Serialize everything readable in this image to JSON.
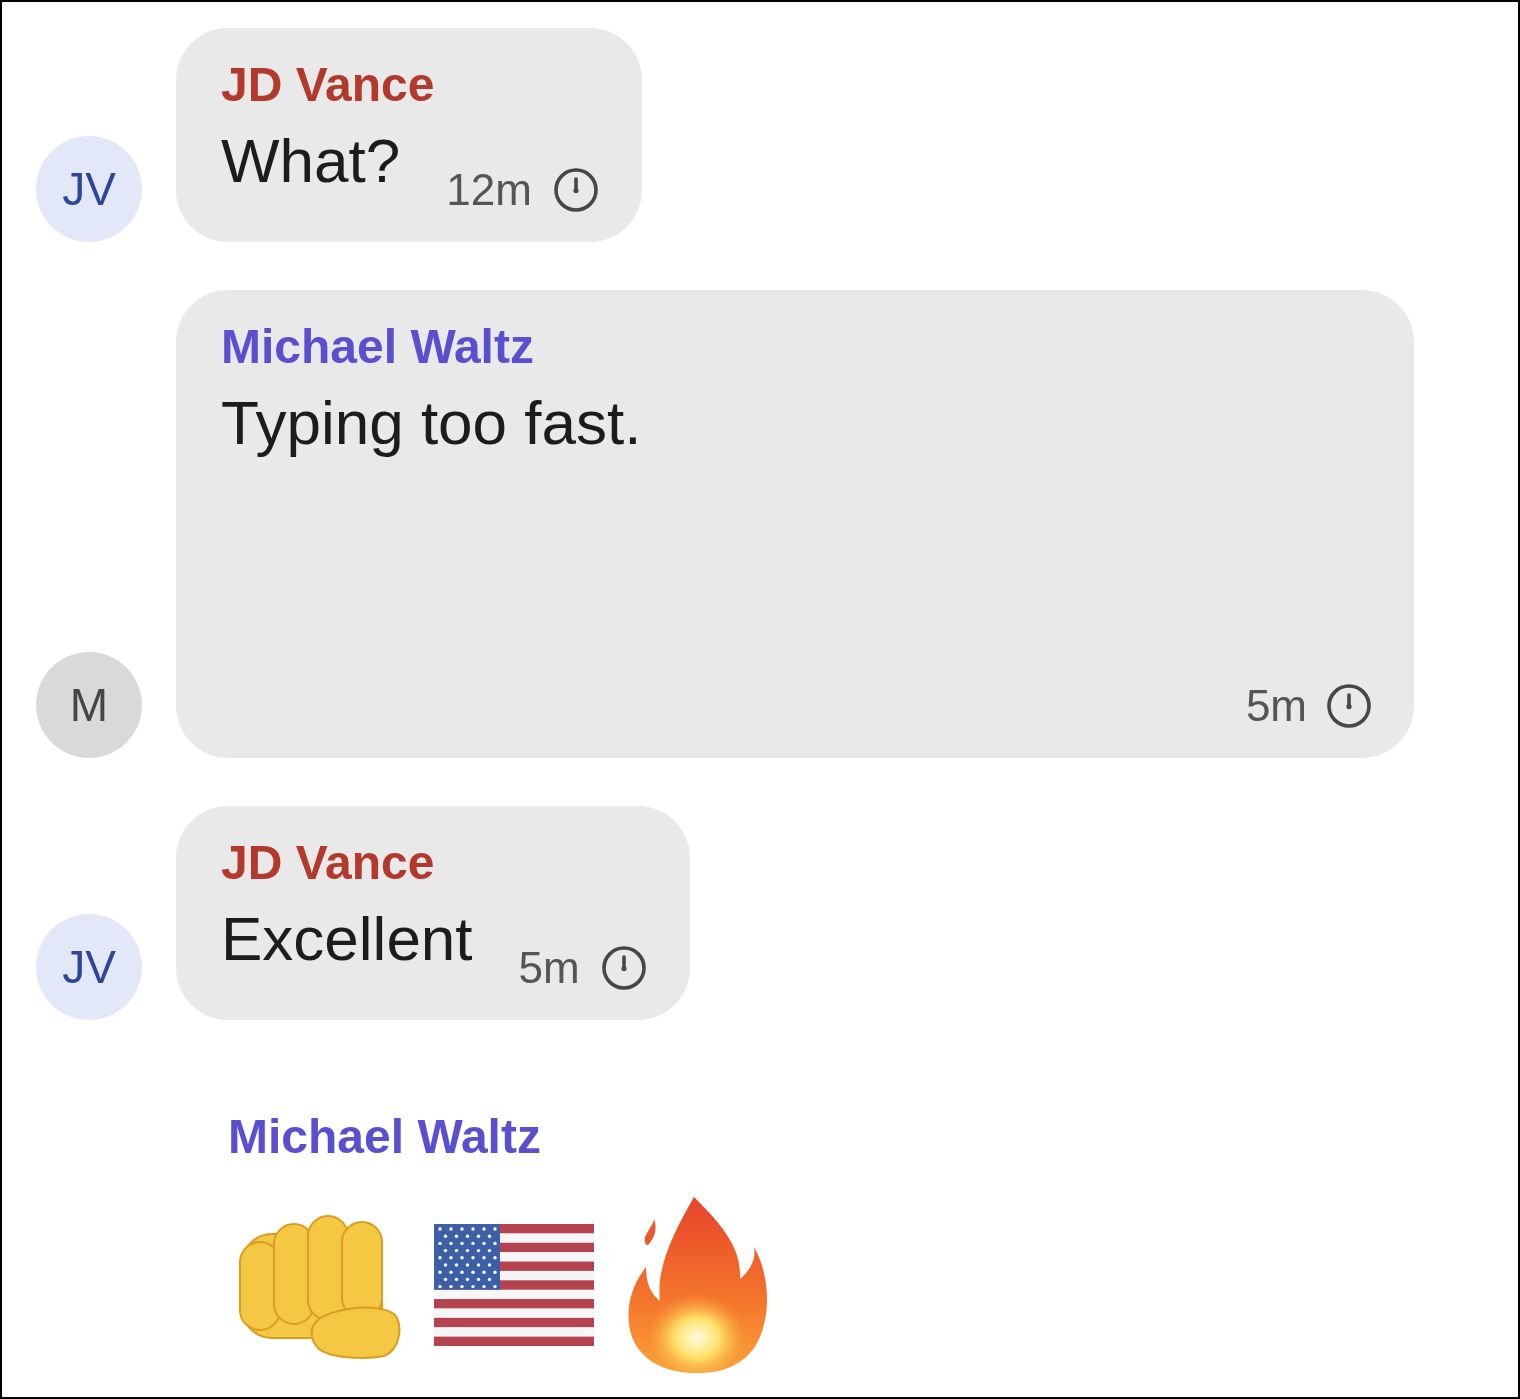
{
  "messages": [
    {
      "kind": "text",
      "sender": "JD Vance",
      "color": "#b3392d",
      "avatar": {
        "initials": "JV",
        "color": "#e3e8f8"
      },
      "text": "What?",
      "time": "12m"
    },
    {
      "kind": "text_wide",
      "sender": "Michael Waltz",
      "color": "#5a4fcf",
      "avatar": {
        "initials": "M",
        "color": "#d9d9d9"
      },
      "text": "Typing too fast.",
      "time": "5m"
    },
    {
      "kind": "text",
      "sender": "JD Vance",
      "color": "#b3392d",
      "avatar": {
        "initials": "JV",
        "color": "#e3e8f8"
      },
      "text": "Excellent",
      "time": "5m"
    },
    {
      "kind": "emoji",
      "sender": "Michael Waltz",
      "color": "#5a4fcf",
      "emojis": [
        {
          "kind": "fist"
        },
        {
          "kind": "flag"
        },
        {
          "kind": "fire"
        }
      ]
    }
  ]
}
